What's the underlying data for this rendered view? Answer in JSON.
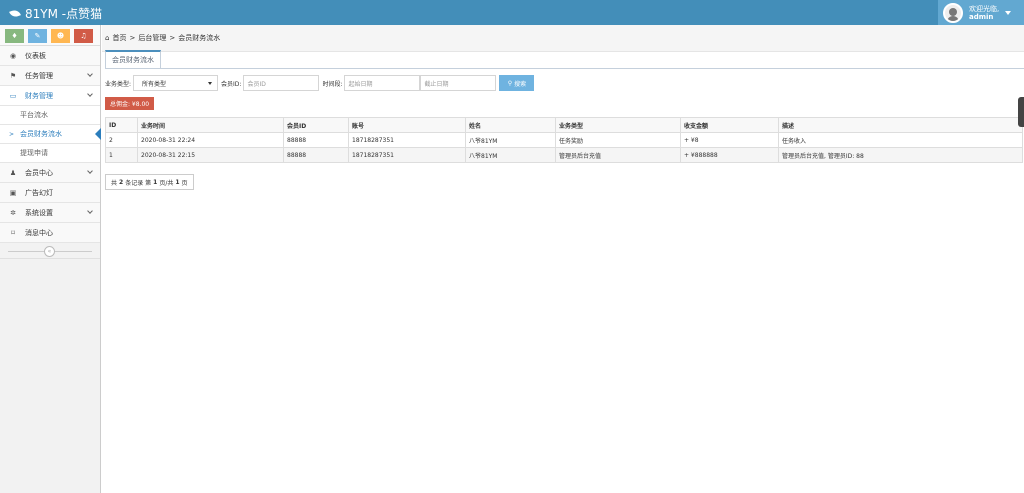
{
  "header": {
    "brand": "81YM -点赞猫",
    "welcome": "欢迎光临,",
    "username": "admin"
  },
  "quick_buttons": [
    {
      "icon": "signal-icon",
      "glyph": "♦"
    },
    {
      "icon": "pencil-icon",
      "glyph": "✎"
    },
    {
      "icon": "users-icon",
      "glyph": "☻"
    },
    {
      "icon": "bell-icon",
      "glyph": "♫"
    }
  ],
  "sidebar": {
    "items": [
      {
        "label": "仪表板",
        "icon": "dashboard-icon",
        "glyph": "◉"
      },
      {
        "label": "任务管理",
        "icon": "flag-icon",
        "glyph": "⚑"
      },
      {
        "label": "财务管理",
        "icon": "finance-icon",
        "glyph": "▭"
      },
      {
        "label": "会员中心",
        "icon": "user-icon",
        "glyph": "♟"
      },
      {
        "label": "广告幻灯",
        "icon": "picture-icon",
        "glyph": "▣"
      },
      {
        "label": "系统设置",
        "icon": "gear-icon",
        "glyph": "✲"
      },
      {
        "label": "消息中心",
        "icon": "bookmark-icon",
        "glyph": "⌑"
      }
    ],
    "finance_sub": [
      "平台流水",
      "会员财务流水",
      "提现申请"
    ]
  },
  "breadcrumb": {
    "home": "首页",
    "sep": ">",
    "level2": "后台管理",
    "level3": "会员财务流水"
  },
  "tab": {
    "label": "会员财务流水"
  },
  "filters": {
    "type_label": "业务类型:",
    "type_value": "所有类型",
    "member_label": "会员ID:",
    "member_placeholder": "会员ID",
    "time_label": "时间段:",
    "start_placeholder": "起始日期",
    "end_placeholder": "截止日期",
    "search_label": "搜索"
  },
  "total": {
    "label": "总佣金: ¥8.00"
  },
  "table": {
    "headers": [
      "ID",
      "业务时间",
      "会员ID",
      "账号",
      "姓名",
      "业务类型",
      "收支金额",
      "描述"
    ],
    "rows": [
      [
        "2",
        "2020-08-31 22:24",
        "88888",
        "18718287351",
        "八爷81YM",
        "任务奖励",
        "+ ¥8",
        "任务收入"
      ],
      [
        "1",
        "2020-08-31 22:15",
        "88888",
        "18718287351",
        "八爷81YM",
        "管理员后台充值",
        "+ ¥888888",
        "管理员后台充值, 管理员ID: 88"
      ]
    ]
  },
  "pager": {
    "prefix": "共",
    "records": "2",
    "mid1": "条记录 第",
    "page": "1",
    "mid2": "页/共",
    "pages": "1",
    "suffix": "页"
  },
  "colors": {
    "topbar": "#438eb9",
    "accent": "#2b7dbc",
    "danger": "#d15b47",
    "search": "#6fb3e0"
  }
}
